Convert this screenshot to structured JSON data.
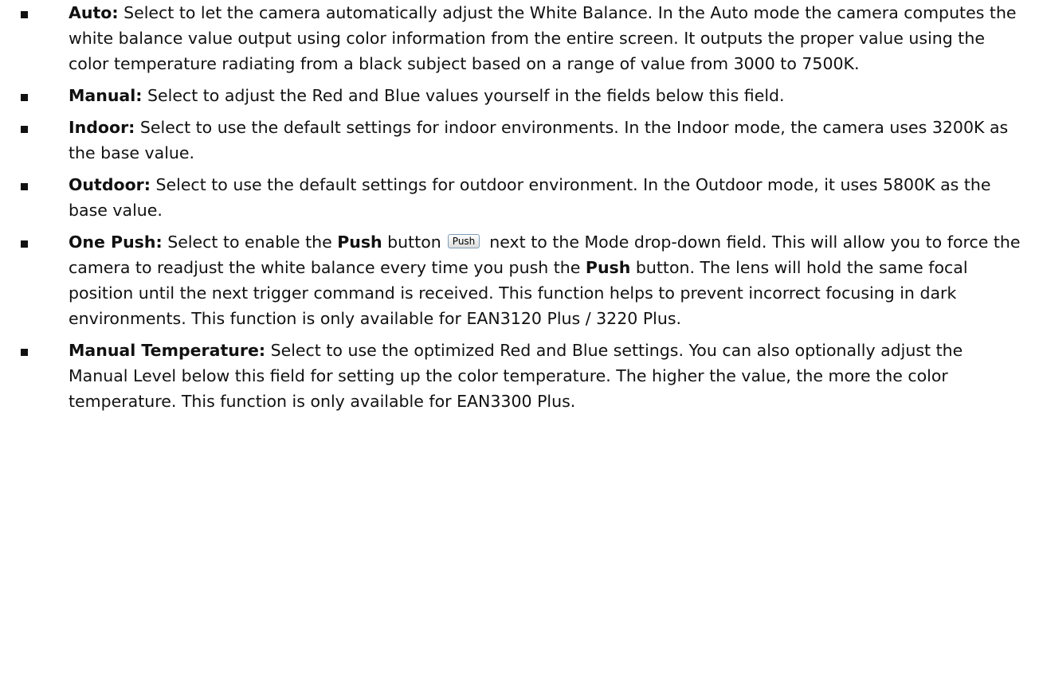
{
  "items": [
    {
      "term": "Auto:",
      "text": " Select to let the camera automatically adjust the White Balance. In the Auto mode the camera computes the white balance value output using color information from the entire screen. It outputs the proper value using the color temperature radiating from a black subject based on a range of value from 3000 to 7500K."
    },
    {
      "term": "Manual:",
      "text": " Select to adjust the Red and Blue values yourself in the fields below this field."
    },
    {
      "term": "Indoor:",
      "text": " Select to use the default settings for indoor environments. In the Indoor mode, the camera uses 3200K as the base value."
    },
    {
      "term": "Outdoor:",
      "text": " Select to use the default settings for outdoor environment. In the Outdoor mode, it uses 5800K as the base value."
    },
    {
      "term": "One Push:",
      "text_a": " Select to enable the ",
      "bold_a": "Push",
      "text_b": " button",
      "button_label": "Push",
      "text_c": "next to the Mode drop-down field. This will allow you to force the camera to readjust the white balance every time you push the ",
      "bold_b": "Push",
      "text_d": " button. The lens will hold the same focal position until the next trigger command is received. This function helps to prevent incorrect focusing in dark environments. This function is only available for EAN3120 Plus / 3220 Plus."
    },
    {
      "term": "Manual Temperature:",
      "text": " Select to use the optimized Red and Blue settings. You can also optionally adjust the Manual Level below this field for setting up the color temperature. The higher the value, the more the color temperature. This function is only available for EAN3300 Plus."
    }
  ]
}
